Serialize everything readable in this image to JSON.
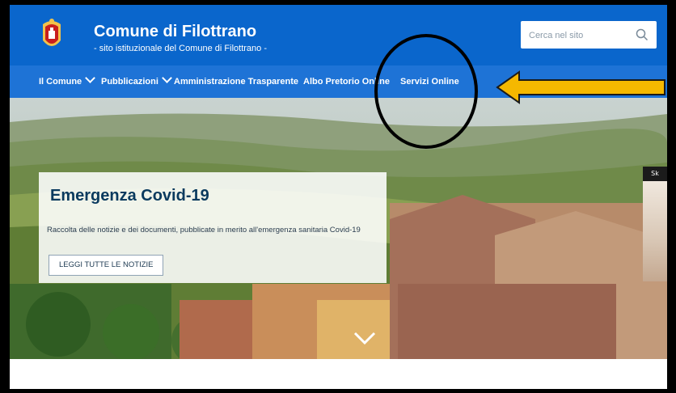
{
  "header": {
    "title": "Comune di Filottrano",
    "subtitle": "- sito istituzionale del Comune di Filottrano -",
    "search_placeholder": "Cerca nel sito",
    "colors": {
      "header_bg": "#0a66cc",
      "nav_bg": "#1e73d6"
    }
  },
  "nav": {
    "items": [
      {
        "label": "Il Comune",
        "has_dropdown": true
      },
      {
        "label": "Pubblicazioni",
        "has_dropdown": true
      },
      {
        "label": "Amministrazione Trasparente",
        "has_dropdown": false
      },
      {
        "label": "Albo Pretorio Online",
        "has_dropdown": false
      },
      {
        "label": "Servizi Online",
        "has_dropdown": false
      }
    ]
  },
  "hero": {
    "title": "Emergenza Covid-19",
    "text": "Raccolta delle notizie e dei documenti, pubblicate in merito all'emergenza sanitaria Covid-19",
    "button_label": "LEGGI TUTTE LE NOTIZIE"
  },
  "side_widget": {
    "label": "Sk"
  },
  "annotations": {
    "highlight": "circle-around-servizi-online",
    "arrow_color": "#f5b800"
  }
}
